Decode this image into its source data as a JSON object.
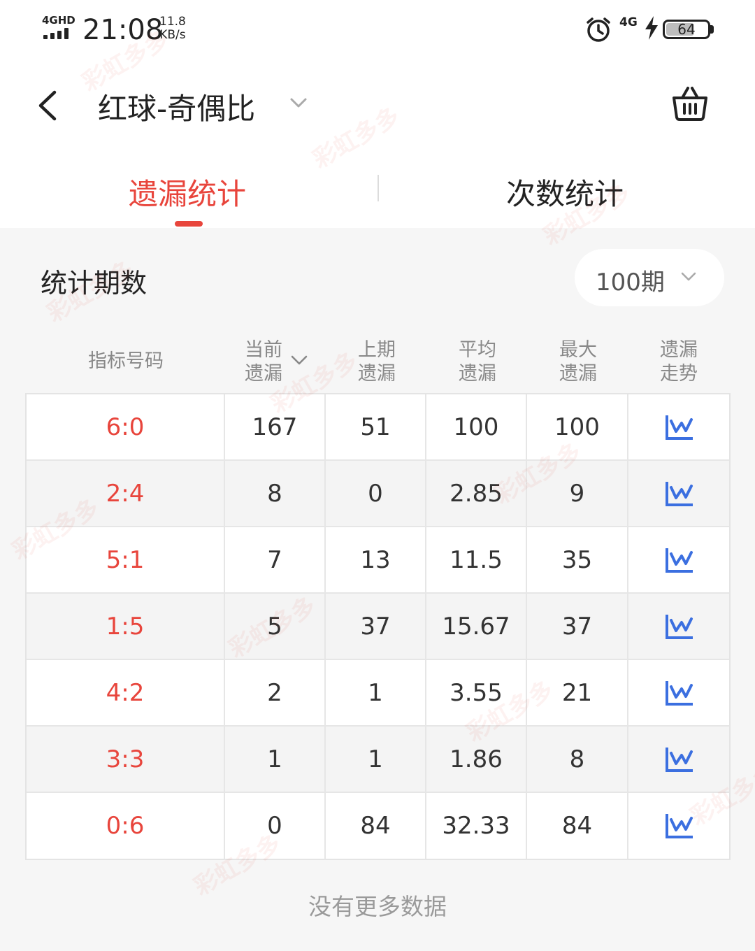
{
  "status_bar": {
    "network": "4GHD",
    "time": "21:08",
    "speed_value": "11.8",
    "speed_unit": "KB/s",
    "network_right": "4G",
    "battery": "64"
  },
  "nav": {
    "title": "红球-奇偶比",
    "icons": [
      "chevron-left-icon",
      "chevron-down-icon",
      "basket-icon"
    ]
  },
  "tabs": [
    {
      "label": "遗漏统计",
      "active": true
    },
    {
      "label": "次数统计",
      "active": false
    }
  ],
  "period": {
    "label": "统计期数",
    "value": "100期"
  },
  "table": {
    "headers": [
      {
        "line1": "指标号码",
        "line2": ""
      },
      {
        "line1": "当前",
        "line2": "遗漏"
      },
      {
        "line1": "上期",
        "line2": "遗漏"
      },
      {
        "line1": "平均",
        "line2": "遗漏"
      },
      {
        "line1": "最大",
        "line2": "遗漏"
      },
      {
        "line1": "遗漏",
        "line2": "走势"
      }
    ],
    "rows": [
      {
        "code": "6:0",
        "current": "167",
        "last": "51",
        "avg": "100",
        "max": "100"
      },
      {
        "code": "2:4",
        "current": "8",
        "last": "0",
        "avg": "2.85",
        "max": "9"
      },
      {
        "code": "5:1",
        "current": "7",
        "last": "13",
        "avg": "11.5",
        "max": "35"
      },
      {
        "code": "1:5",
        "current": "5",
        "last": "37",
        "avg": "15.67",
        "max": "37"
      },
      {
        "code": "4:2",
        "current": "2",
        "last": "1",
        "avg": "3.55",
        "max": "21"
      },
      {
        "code": "3:3",
        "current": "1",
        "last": "1",
        "avg": "1.86",
        "max": "8"
      },
      {
        "code": "0:6",
        "current": "0",
        "last": "84",
        "avg": "32.33",
        "max": "84"
      }
    ]
  },
  "footer": "没有更多数据",
  "watermark": "彩虹多多",
  "colors": {
    "accent": "#e8453c",
    "trend_icon": "#3b6fe0"
  }
}
